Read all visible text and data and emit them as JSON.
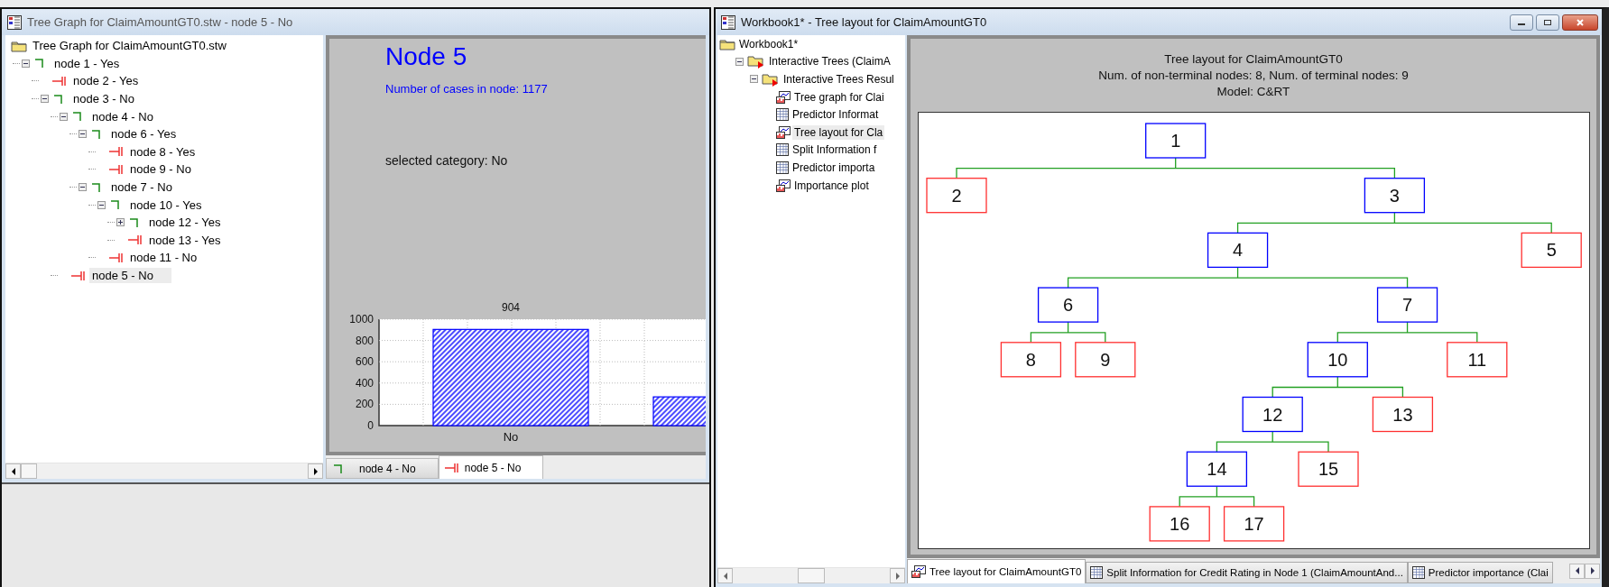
{
  "left_window": {
    "title": "Tree Graph for ClaimAmountGT0.stw - node 5 - No",
    "tree": {
      "root_label": "Tree Graph for ClaimAmountGT0.stw",
      "nodes": [
        {
          "number": "1",
          "label": "node 1 - Yes",
          "expanded": true,
          "selected": false,
          "children": [
            {
              "number": "2",
              "label": "node 2 - Yes",
              "selected": false
            },
            {
              "number": "3",
              "label": "node 3 - No",
              "expanded": true,
              "selected": false,
              "children": [
                {
                  "number": "4",
                  "label": "node 4 - No",
                  "expanded": true,
                  "selected": false,
                  "children": [
                    {
                      "number": "6",
                      "label": "node 6 - Yes",
                      "expanded": true,
                      "selected": false,
                      "children": [
                        {
                          "number": "8",
                          "label": "node 8 - Yes",
                          "selected": false
                        },
                        {
                          "number": "9",
                          "label": "node 9 - No",
                          "selected": false
                        }
                      ]
                    },
                    {
                      "number": "7",
                      "label": "node 7 - No",
                      "expanded": true,
                      "selected": false,
                      "children": [
                        {
                          "number": "10",
                          "label": "node 10 - Yes",
                          "expanded": true,
                          "selected": false,
                          "children": [
                            {
                              "number": "12",
                              "label": "node 12 - Yes",
                              "expanded": false,
                              "selected": false,
                              "children": [
                                {
                                  "number": "14",
                                  "children": [
                                    {
                                      "number": "16"
                                    },
                                    {
                                      "number": "17"
                                    }
                                  ]
                                },
                                {
                                  "number": "15"
                                }
                              ]
                            },
                            {
                              "number": "13",
                              "label": "node 13 - Yes",
                              "selected": false
                            }
                          ]
                        },
                        {
                          "number": "11",
                          "label": "node 11 - No",
                          "selected": false
                        }
                      ]
                    }
                  ]
                },
                {
                  "number": "5",
                  "label": "node 5 - No",
                  "selected": true
                }
              ]
            }
          ]
        }
      ]
    },
    "node_view": {
      "title": "Node 5",
      "cases": "Number of cases in node: 1177",
      "category": "selected category: No",
      "chart_data": {
        "type": "bar",
        "categories": [
          "No",
          null
        ],
        "series": [
          {
            "color": "#0000ff",
            "values": [
              904,
              270
            ]
          }
        ],
        "ylim": [
          0,
          1000
        ],
        "yticks": [
          0,
          200,
          400,
          600,
          800,
          1000
        ],
        "grid": true,
        "value_labels": [
          "904"
        ]
      }
    },
    "tabs": [
      {
        "label": "node 4 - No",
        "kind": "split",
        "selected": false
      },
      {
        "label": "node 5 - No",
        "kind": "terminal",
        "selected": true
      }
    ]
  },
  "right_window": {
    "title": "Workbook1* - Tree layout for ClaimAmountGT0",
    "navigator": [
      {
        "label": "Workbook1*",
        "kind": "folder",
        "selected": false,
        "children": [
          {
            "label": "Interactive Trees (ClaimA",
            "kind": "analysis",
            "expanded": true,
            "selected": false,
            "children": [
              {
                "label": "Interactive Trees Resul",
                "kind": "analysis",
                "expanded": true,
                "selected": false,
                "children": [
                  {
                    "label": "Tree graph for Clai",
                    "kind": "graph",
                    "selected": false
                  },
                  {
                    "label": "Predictor Informat",
                    "kind": "table",
                    "selected": false
                  },
                  {
                    "label": "Tree layout for Cla",
                    "kind": "graph",
                    "selected": true
                  },
                  {
                    "label": "Split Information f",
                    "kind": "table",
                    "selected": false
                  },
                  {
                    "label": "Predictor importa",
                    "kind": "table",
                    "selected": false
                  },
                  {
                    "label": "Importance plot",
                    "kind": "graph",
                    "selected": false
                  }
                ]
              }
            ]
          }
        ]
      }
    ],
    "layout_header": [
      "Tree layout for ClaimAmountGT0",
      "Num. of non-terminal nodes: 8,  Num. of terminal nodes: 9",
      "Model: C&RT"
    ],
    "tabs": [
      {
        "label": "Tree layout for ClaimAmountGT0",
        "kind": "graph",
        "selected": true
      },
      {
        "label": "Split Information for Credit Rating in Node 1 (ClaimAmountAnd...",
        "kind": "table",
        "selected": false
      },
      {
        "label": "Predictor importance (Clai",
        "kind": "table",
        "selected": false
      }
    ]
  }
}
